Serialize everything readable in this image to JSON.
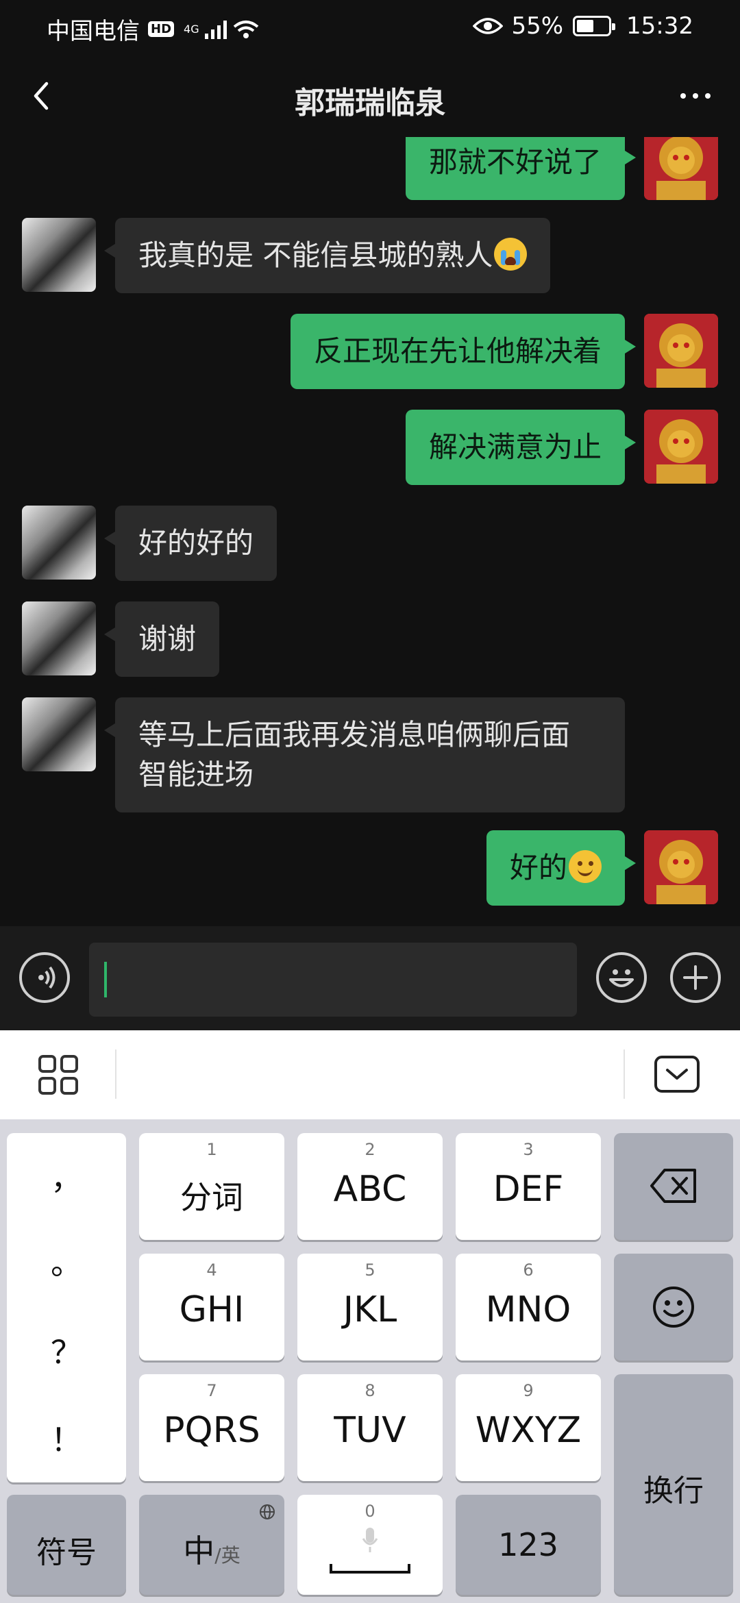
{
  "status": {
    "carrier": "中国电信",
    "hd": "HD",
    "network": "4G",
    "battery": "55%",
    "battery_fraction": 0.55,
    "time": "15:32"
  },
  "header": {
    "title": "郭瑞瑞临泉"
  },
  "messages": [
    {
      "side": "out",
      "text": "那就不好说了"
    },
    {
      "side": "in",
      "text": "我真的是 不能信县城的熟人",
      "emoji": "crying-face"
    },
    {
      "side": "out",
      "text": "反正现在先让他解决着"
    },
    {
      "side": "out",
      "text": "解决满意为止"
    },
    {
      "side": "in",
      "text": "好的好的"
    },
    {
      "side": "in",
      "text": "谢谢"
    },
    {
      "side": "in",
      "text": "等马上后面我再发消息咱俩聊后面\n智能进场"
    },
    {
      "side": "out",
      "text": "好的",
      "emoji": "smiling-face"
    }
  ],
  "input": {
    "value": ""
  },
  "keyboard": {
    "punctuation": [
      "，",
      "。",
      "？",
      "！"
    ],
    "keys": [
      {
        "num": "1",
        "label": "分词"
      },
      {
        "num": "2",
        "label": "ABC"
      },
      {
        "num": "3",
        "label": "DEF"
      },
      {
        "num": "4",
        "label": "GHI"
      },
      {
        "num": "5",
        "label": "JKL"
      },
      {
        "num": "6",
        "label": "MNO"
      },
      {
        "num": "7",
        "label": "PQRS"
      },
      {
        "num": "8",
        "label": "TUV"
      },
      {
        "num": "9",
        "label": "WXYZ"
      }
    ],
    "symbols": "符号",
    "lang_main": "中",
    "lang_alt": "/英",
    "space_num": "0",
    "numbers": "123",
    "enter": "换行"
  },
  "colors": {
    "outgoing_bubble": "#3ab56a",
    "incoming_bubble": "#2b2b2b",
    "chat_background": "#111111",
    "accent": "#2fb66a"
  }
}
